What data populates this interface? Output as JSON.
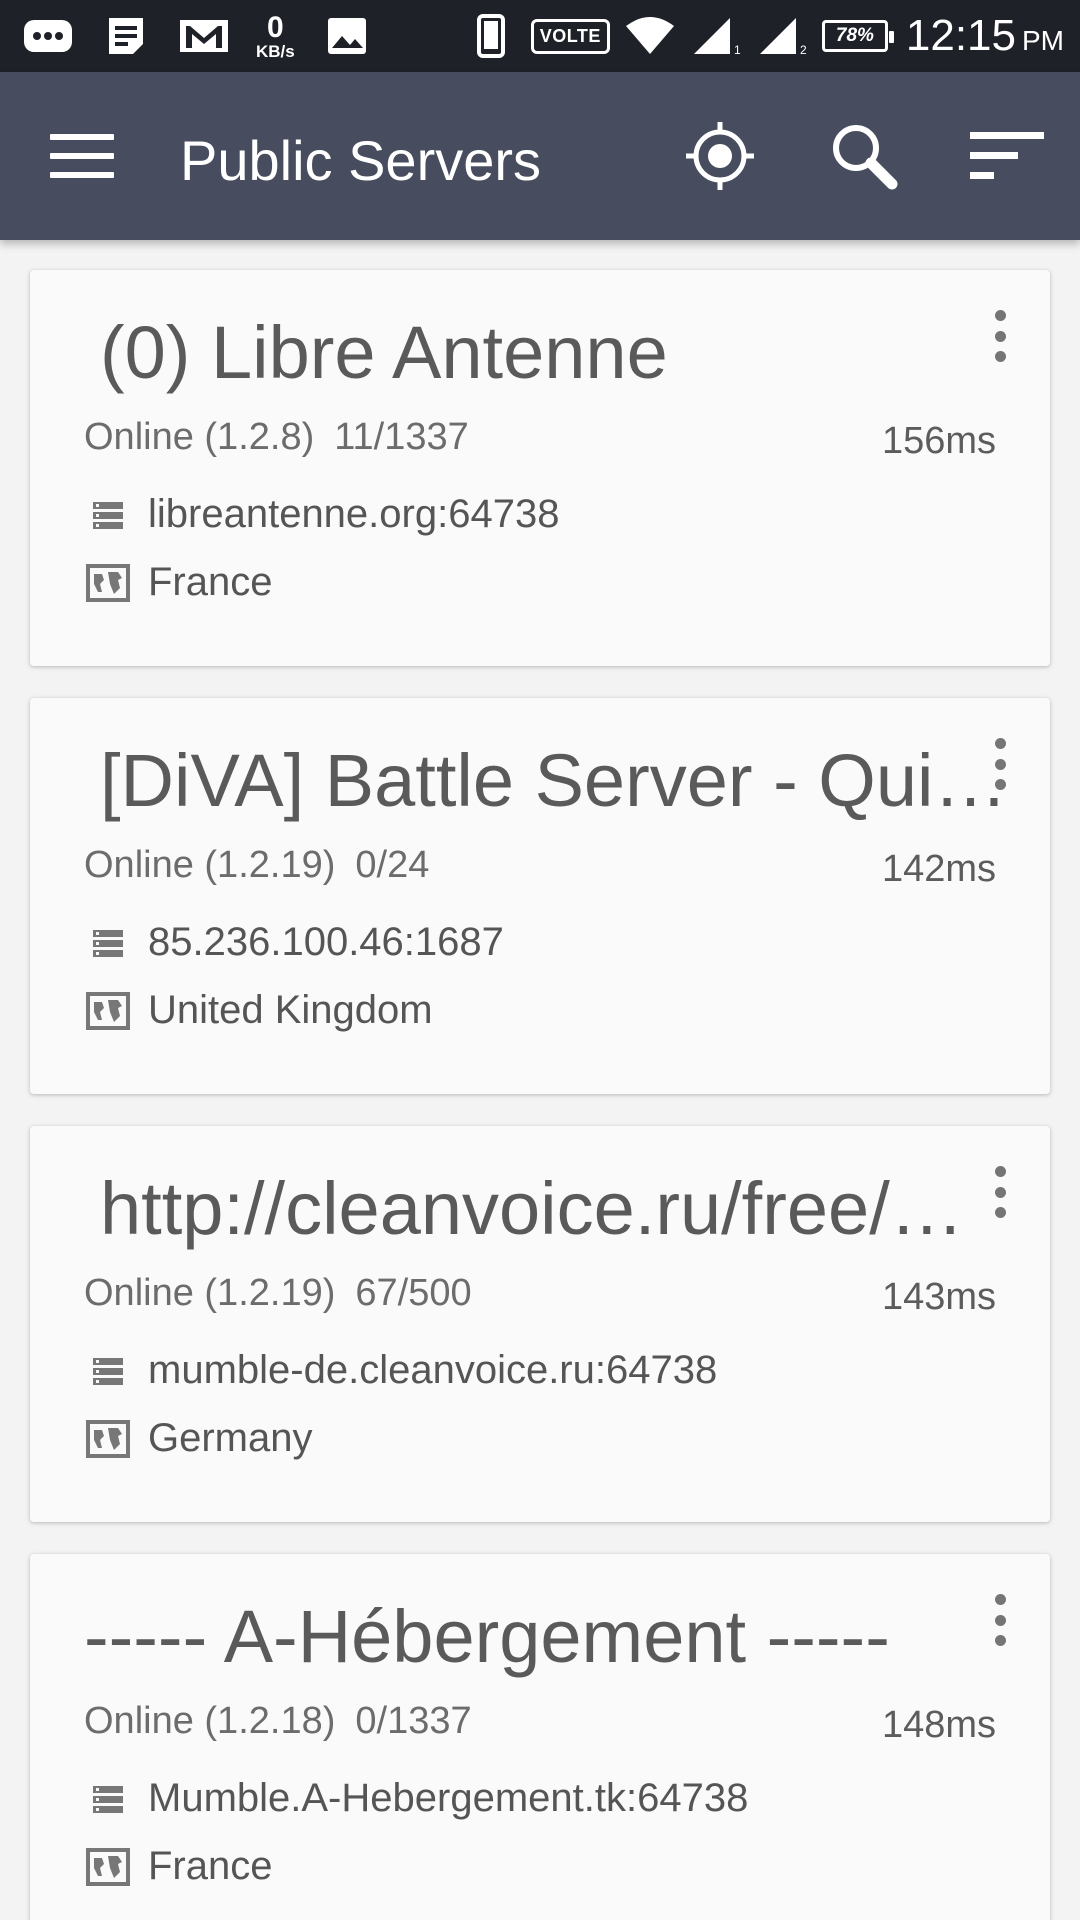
{
  "status_bar": {
    "speed_value": "0",
    "speed_unit": "KB/s",
    "volte": "VOLTE",
    "battery": "78%",
    "time": "12:15",
    "ampm": "PM",
    "icons": [
      "chat-notification-icon",
      "document-notification-icon",
      "gmail-icon",
      "image-icon",
      "phone-icon",
      "wifi-icon",
      "signal-sim1-icon",
      "signal-sim2-icon",
      "battery-icon"
    ]
  },
  "appbar": {
    "title": "Public Servers",
    "icons": [
      "menu-icon",
      "locate-icon",
      "search-icon",
      "sort-icon"
    ]
  },
  "servers": [
    {
      "name": "(0) Libre Antenne",
      "status": "Online (1.2.8)",
      "users": "11/1337",
      "ping": "156ms",
      "host": "libreantenne.org:64738",
      "country": "France"
    },
    {
      "name": "[DiVA] Battle Server - Quick Join",
      "status": "Online (1.2.19)",
      "users": "0/24",
      "ping": "142ms",
      "host": "85.236.100.46:1687",
      "country": "United Kingdom"
    },
    {
      "name": "http://cleanvoice.ru/free/mumble",
      "status": "Online (1.2.19)",
      "users": "67/500",
      "ping": "143ms",
      "host": "mumble-de.cleanvoice.ru:64738",
      "country": "Germany"
    },
    {
      "name": "----- A-Hébergement -----",
      "status": "Online (1.2.18)",
      "users": "0/1337",
      "ping": "148ms",
      "host": "Mumble.A-Hebergement.tk:64738",
      "country": "France"
    }
  ]
}
